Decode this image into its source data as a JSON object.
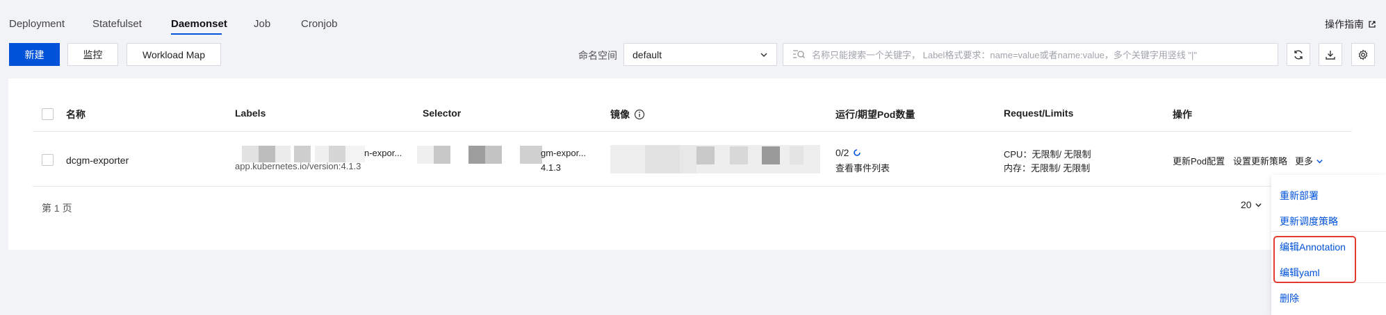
{
  "tabs": [
    {
      "label": "Deployment"
    },
    {
      "label": "Statefulset"
    },
    {
      "label": "Daemonset"
    },
    {
      "label": "Job"
    },
    {
      "label": "Cronjob"
    }
  ],
  "active_tab": "Daemonset",
  "guide_link": "操作指南",
  "toolbar": {
    "new_button": "新建",
    "monitor_button": "监控",
    "workload_map_button": "Workload Map",
    "namespace_label": "命名空间",
    "namespace_value": "default",
    "search_placeholder": "名称只能搜索一个关键字， Label格式要求：name=value或者name:value，多个关键字用竖线 \"|\""
  },
  "table": {
    "headers": {
      "name": "名称",
      "labels": "Labels",
      "selector": "Selector",
      "image": "镜像",
      "pods": "运行/期望Pod数量",
      "request_limits": "Request/Limits",
      "actions": "操作"
    },
    "row": {
      "name": "dcgm-exporter",
      "labels_line1": "n-expor...",
      "labels_line2": "app.kubernetes.io/version:4.1.3",
      "selector_line1": "gm-expor...",
      "selector_line2": "4.1.3",
      "pods_count": "0/2",
      "events_link": "查看事件列表",
      "cpu": "CPU：无限制/ 无限制",
      "memory": "内存：无限制/ 无限制",
      "action_update_pod": "更新Pod配置",
      "action_update_strategy": "设置更新策略",
      "action_more": "更多"
    }
  },
  "pager": {
    "page_text": "第 1 页",
    "page_size": "20"
  },
  "more_menu": {
    "items": [
      {
        "label": "重新部署"
      },
      {
        "label": "更新调度策略"
      },
      {
        "label": "编辑Annotation"
      },
      {
        "label": "编辑yaml"
      },
      {
        "label": "删除"
      }
    ]
  },
  "colors": {
    "primary": "#0052d9",
    "highlight": "#e33a2d"
  }
}
